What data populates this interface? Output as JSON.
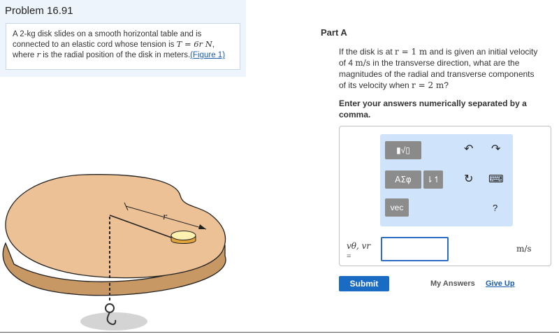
{
  "problem": {
    "title": "Problem 16.91",
    "text_1": "A 2-",
    "kg": "kg",
    "text_2": " disk slides on a smooth horizontal table and is connected to an elastic cord whose tension is ",
    "tension_expr": "T = 6r N",
    "text_3": ", where ",
    "r_symbol": "r",
    "text_4": " is the radial position of the disk in meters.",
    "figure_link": "(Figure 1)"
  },
  "figure": {
    "r_label": "r"
  },
  "part": {
    "title": "Part A",
    "q_1": "If the disk is at ",
    "q_r1": "r = 1 m",
    "q_2": " and is given an initial velocity of 4 ",
    "q_unit": "m/s",
    "q_3": " in the transverse direction, what are the magnitudes of the radial and transverse components of its velocity when ",
    "q_r2": "r = 2 m",
    "q_4": "?",
    "instruction": "Enter your answers numerically separated by a comma."
  },
  "toolbar": {
    "frac_label": "▮√▯",
    "greek_label": "ΑΣφ",
    "sort_label": "⇂↿",
    "vec_label": "vec",
    "undo_icon": "↶",
    "redo_icon": "↷",
    "reset_icon": "↻",
    "keyboard_icon": "⌨",
    "help_label": "?"
  },
  "answer": {
    "variable_label": "vθ, vr",
    "equals": "=",
    "value": "",
    "unit": "m/s"
  },
  "actions": {
    "submit_label": "Submit",
    "my_answers_label": "My Answers",
    "give_up_label": "Give Up"
  }
}
